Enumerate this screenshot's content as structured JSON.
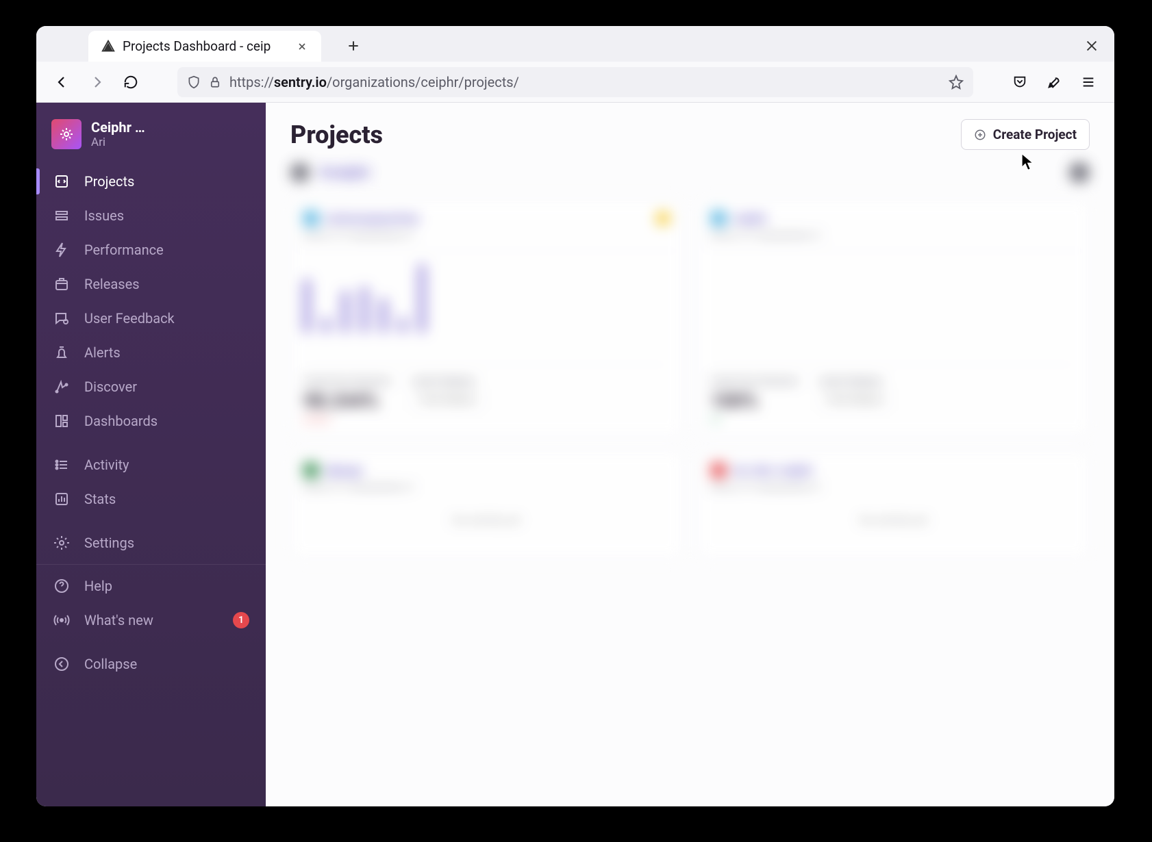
{
  "browser": {
    "tab_title": "Projects Dashboard - ceip",
    "url_prefix": "https://",
    "url_host": "sentry.io",
    "url_path": "/organizations/ceiphr/projects/"
  },
  "org": {
    "name": "Ceiphr …",
    "user": "Ari"
  },
  "nav": {
    "projects": "Projects",
    "issues": "Issues",
    "performance": "Performance",
    "releases": "Releases",
    "user_feedback": "User Feedback",
    "alerts": "Alerts",
    "discover": "Discover",
    "dashboards": "Dashboards",
    "activity": "Activity",
    "stats": "Stats",
    "settings": "Settings",
    "help": "Help",
    "whats_new": "What's new",
    "whats_new_badge": "1",
    "collapse": "Collapse"
  },
  "main": {
    "title": "Projects",
    "create_project": "Create Project"
  },
  "blurred": {
    "team": "#ceiphr",
    "card1_title": "ariannaspeechas",
    "card_sub": "errors: 2? | transactions: 0",
    "card2_title": "ceiphr",
    "stat_label": "Crash Free Sessions",
    "deploy_label": "Latest Deploys",
    "val1": "98.244%",
    "val1_sub": "0.076%",
    "val2": "100%",
    "val2_sub": "0%",
    "deploy_btn": "Track Deploys",
    "card3_title": "django",
    "card4_title": "ios-dev-ceiphr",
    "no_activity": "No activity yet"
  }
}
